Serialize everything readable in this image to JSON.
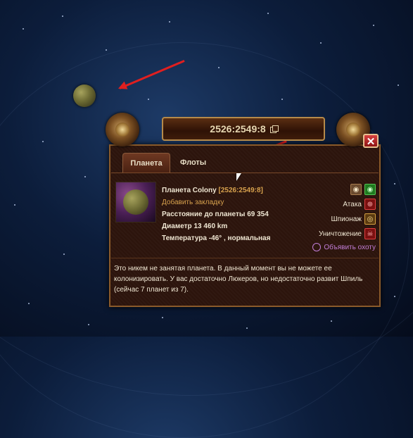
{
  "popup": {
    "coordinates": "2526:2549:8",
    "close_label": "✕",
    "tabs": [
      {
        "label": "Планета",
        "active": true
      },
      {
        "label": "Флоты",
        "active": false
      }
    ],
    "planet": {
      "name_prefix": "Планета Colony",
      "coords_link": "[2526:2549:8]",
      "bookmark": "Добавить закладку",
      "distance": "Расстояние до планеты 69 354",
      "diameter": "Диаметр 13 460 km",
      "temperature": "Температура -46° , нормальная"
    },
    "actions": [
      {
        "label": "Атака"
      },
      {
        "label": "Шпионаж"
      },
      {
        "label": "Уничтожение"
      }
    ],
    "hunt_label": "Объявить охоту",
    "description": "Это никем не занятая планета. В данный момент вы не можете ее колонизировать. У вас достаточно Люкеров, но недостаточно развит Шпиль (сейчас 7 планет из 7)."
  },
  "colors": {
    "accent": "#d7a14d",
    "attack_red": "#e04040",
    "hunt_purple": "#c27ed8",
    "active_green": "#1f7a1f"
  },
  "icons": [
    "eye-icon",
    "green-eye-icon",
    "crosshair-icon",
    "spy-icon",
    "skull-icon",
    "copy-icon",
    "close-icon",
    "target-icon"
  ]
}
